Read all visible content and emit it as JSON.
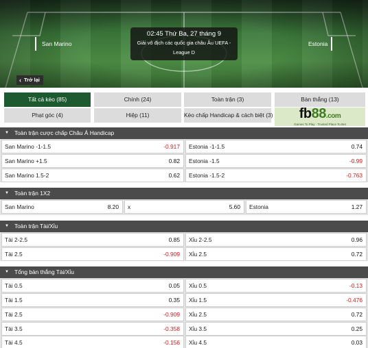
{
  "match": {
    "home_team": "San Marino",
    "away_team": "Estonia",
    "time": "02:45 Thứ Ba, 27 tháng 9",
    "league_line1": "Giải vô địch các quốc gia châu Âu UEFA -",
    "league_line2": "League D",
    "back_label": "Trở lại"
  },
  "tabs": [
    {
      "label": "Tất cả kèo (85)",
      "active": true
    },
    {
      "label": "Chính (24)"
    },
    {
      "label": "Toàn trận (3)"
    },
    {
      "label": "Bàn thắng (13)"
    },
    {
      "label": "Phạt góc (4)"
    },
    {
      "label": "Hiệp (11)"
    },
    {
      "label": "Kèo chấp Handicap & cách biệt (3)"
    }
  ],
  "logo": {
    "fb": "fb",
    "n88": "88",
    "com": ".com",
    "tagline": "Games To Play · Trusted Place To Bet"
  },
  "sections": [
    {
      "title": "Toàn trận cược chấp Châu Á Handicap",
      "rows": [
        [
          {
            "label": "San Marino -1-1.5",
            "value": "-0.917"
          },
          {
            "label": "Estonia -1-1.5",
            "value": "0.74"
          }
        ],
        [
          {
            "label": "San Marino +1.5",
            "value": "0.82"
          },
          {
            "label": "Estonia -1.5",
            "value": "-0.99"
          }
        ],
        [
          {
            "label": "San Marino 1.5-2",
            "value": "0.62"
          },
          {
            "label": "Estonia -1.5-2",
            "value": "-0.763"
          }
        ]
      ]
    },
    {
      "title": "Toàn trận 1X2",
      "rows": [
        [
          {
            "label": "San Marino",
            "value": "8.20"
          },
          {
            "label": "x",
            "value": "5.60"
          },
          {
            "label": "Estonia",
            "value": "1.27"
          }
        ]
      ]
    },
    {
      "title": "Toàn trận Tài/Xỉu",
      "rows": [
        [
          {
            "label": "Tài 2-2.5",
            "value": "0.85"
          },
          {
            "label": "Xỉu 2-2.5",
            "value": "0.96"
          }
        ],
        [
          {
            "label": "Tài 2.5",
            "value": "-0.909"
          },
          {
            "label": "Xỉu 2.5",
            "value": "0.72"
          }
        ]
      ]
    },
    {
      "title": "Tổng bàn thắng Tài/Xỉu",
      "rows": [
        [
          {
            "label": "Tài 0.5",
            "value": "0.05"
          },
          {
            "label": "Xỉu 0.5",
            "value": "-0.13"
          }
        ],
        [
          {
            "label": "Tài 1.5",
            "value": "0.35"
          },
          {
            "label": "Xỉu 1.5",
            "value": "-0.476"
          }
        ],
        [
          {
            "label": "Tài 2.5",
            "value": "-0.909"
          },
          {
            "label": "Xỉu 2.5",
            "value": "0.72"
          }
        ],
        [
          {
            "label": "Tài 3.5",
            "value": "-0.358"
          },
          {
            "label": "Xỉu 3.5",
            "value": "0.25"
          }
        ],
        [
          {
            "label": "Tài 4.5",
            "value": "-0.156"
          },
          {
            "label": "Xỉu 4.5",
            "value": "0.03"
          }
        ]
      ]
    }
  ],
  "colors": {
    "active_tab": "#1e5a2f",
    "negative": "#d31a1a",
    "section_header": "#4b4b4b"
  }
}
